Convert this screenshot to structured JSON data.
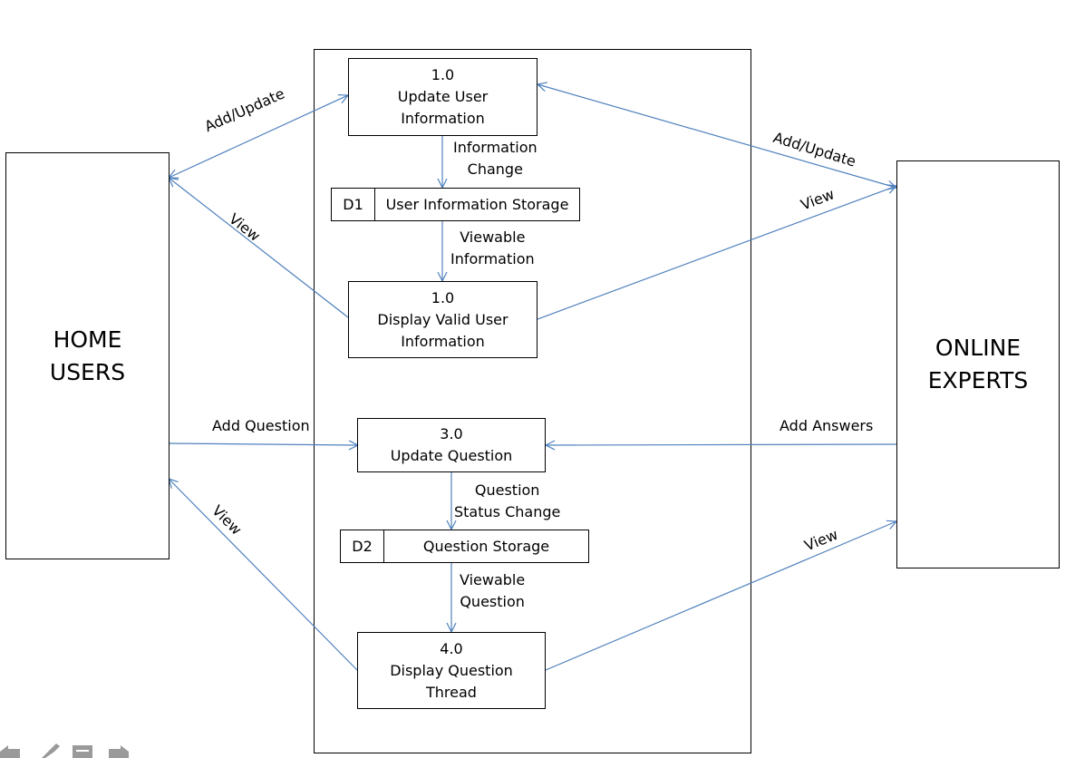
{
  "entities": {
    "home_users": [
      "HOME",
      "USERS"
    ],
    "online_experts": [
      "ONLINE",
      "EXPERTS"
    ]
  },
  "processes": {
    "p1": {
      "id": "1.0",
      "name": [
        "Update User",
        "Information"
      ]
    },
    "p2": {
      "id": "1.0",
      "name": [
        "Display Valid User",
        "Information"
      ]
    },
    "p3": {
      "id": "3.0",
      "name": [
        "Update Question"
      ]
    },
    "p4": {
      "id": "4.0",
      "name": [
        "Display Question",
        "Thread"
      ]
    }
  },
  "stores": {
    "d1": {
      "id": "D1",
      "name": "User Information Storage"
    },
    "d2": {
      "id": "D2",
      "name": "Question Storage"
    }
  },
  "flows": {
    "home_add_update": "Add/Update",
    "home_view_1": "View",
    "experts_add_update": "Add/Update",
    "experts_view_1": "View",
    "info_change": [
      "Information",
      "Change"
    ],
    "viewable_info": [
      "Viewable",
      "Information"
    ],
    "add_question": "Add Question",
    "home_view_2": "View",
    "add_answers": "Add Answers",
    "experts_view_2": "View",
    "question_status_change": [
      "Question",
      "Status Change"
    ],
    "viewable_question": [
      "Viewable",
      "Question"
    ]
  },
  "colors": {
    "flow_line": "#4f81bd",
    "border": "#000000",
    "toolbar_icon": "#9a9a9a"
  },
  "toolbar": {
    "icons": [
      "arrow-left-icon",
      "pen-icon",
      "menu-icon",
      "arrow-right-icon"
    ]
  }
}
